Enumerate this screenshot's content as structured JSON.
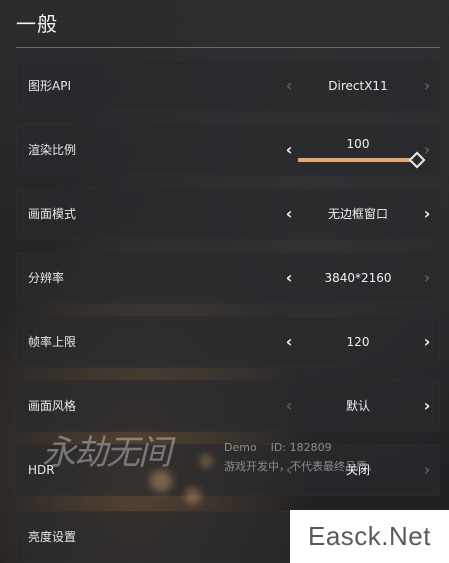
{
  "section": {
    "title": "一般"
  },
  "settings": [
    {
      "label": "图形API",
      "value": "DirectX11",
      "left_enabled": false,
      "right_enabled": false
    },
    {
      "label": "渲染比例",
      "value": "100",
      "left_enabled": true,
      "right_enabled": false,
      "slider_fraction": 1.0
    },
    {
      "label": "画面模式",
      "value": "无边框窗口",
      "left_enabled": true,
      "right_enabled": true
    },
    {
      "label": "分辨率",
      "value": "3840*2160",
      "left_enabled": true,
      "right_enabled": false
    },
    {
      "label": "帧率上限",
      "value": "120",
      "left_enabled": true,
      "right_enabled": true
    },
    {
      "label": "画面风格",
      "value": "默认",
      "left_enabled": false,
      "right_enabled": true
    },
    {
      "label": "HDR",
      "value": "关闭",
      "left_enabled": false,
      "right_enabled": false
    },
    {
      "label": "亮度设置",
      "value": "",
      "left_enabled": false,
      "right_enabled": false
    }
  ],
  "watermark": {
    "logo_text": "永劫无间",
    "demo_line": "Demo    ID: 182809",
    "desc_line": "游戏开发中，不代表最终品质。"
  },
  "site_badge": "Easck.Net",
  "colors": {
    "accent": "#e6a66f",
    "arrow_active": "#f0f0f0",
    "arrow_inactive": "#5a5b5d"
  },
  "icons": {
    "left": "chevron-left-icon",
    "right": "chevron-right-icon",
    "slider": "diamond-knob-icon"
  }
}
